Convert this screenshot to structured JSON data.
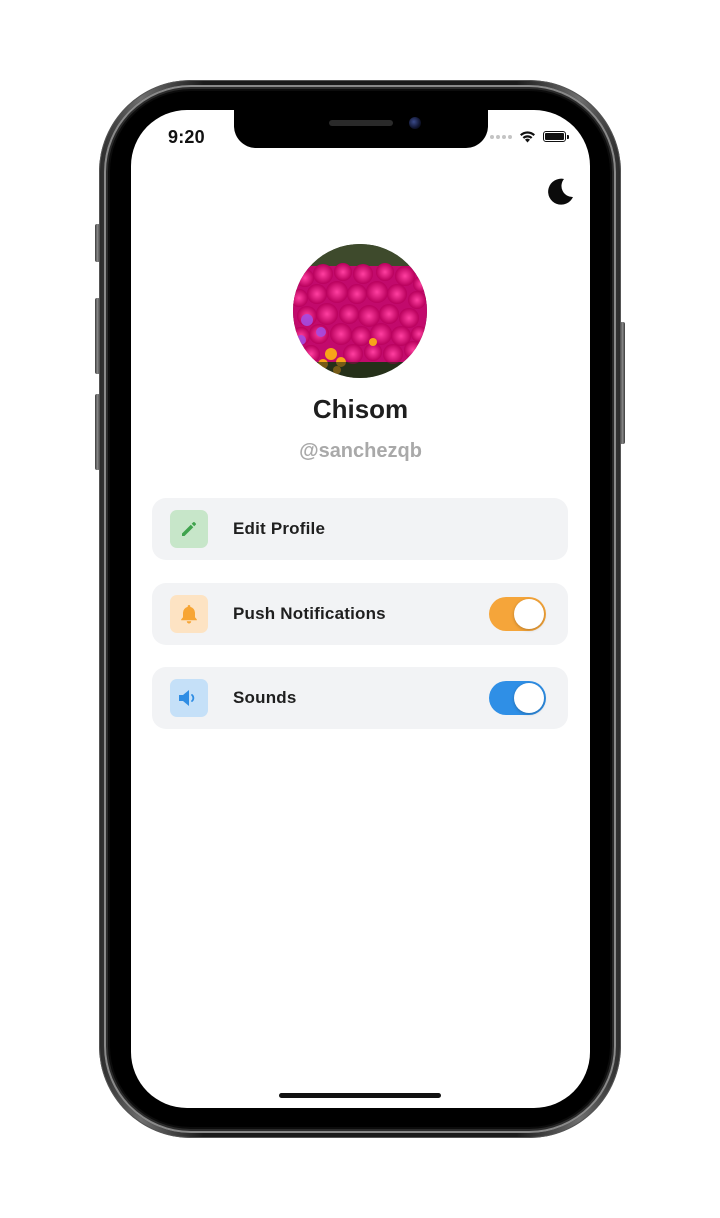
{
  "status_bar": {
    "time": "9:20"
  },
  "header": {
    "theme_toggle_icon": "moon-icon"
  },
  "profile": {
    "name": "Chisom",
    "handle": "@sanchezqb",
    "avatar_description_icon": "avatar"
  },
  "settings": {
    "items": [
      {
        "label": "Edit Profile",
        "icon": "pencil-icon",
        "icon_color": "#3fa34d",
        "icon_bg": "#c7e6c9",
        "has_toggle": false
      },
      {
        "label": "Push Notifications",
        "icon": "bell-icon",
        "icon_color": "#f7a534",
        "icon_bg": "#fde3c3",
        "has_toggle": true,
        "toggle_on": true,
        "toggle_color": "#f5a53a"
      },
      {
        "label": "Sounds",
        "icon": "speaker-icon",
        "icon_color": "#2f8de4",
        "icon_bg": "#c5e0f8",
        "has_toggle": true,
        "toggle_on": true,
        "toggle_color": "#2f8fe6"
      }
    ]
  },
  "colors": {
    "row_background": "#f2f3f5",
    "name_text": "#1e1e1e",
    "handle_text": "#a9a9a9"
  }
}
